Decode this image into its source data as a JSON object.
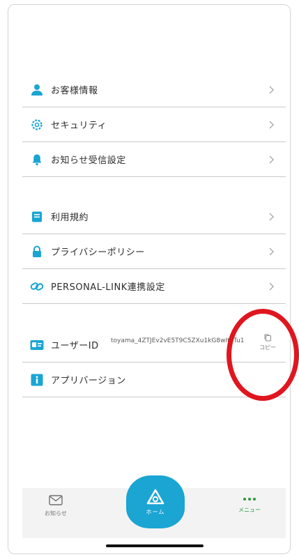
{
  "menu_group_1": [
    {
      "label": "お客様情報",
      "icon": "person-icon"
    },
    {
      "label": "セキュリティ",
      "icon": "gear-icon"
    },
    {
      "label": "お知らせ受信設定",
      "icon": "bell-icon"
    }
  ],
  "menu_group_2": [
    {
      "label": "利用規約",
      "icon": "document-icon"
    },
    {
      "label": "プライバシーポリシー",
      "icon": "lock-icon"
    },
    {
      "label": "PERSONAL-LINK連携設定",
      "icon": "link-icon"
    }
  ],
  "user_id": {
    "label": "ユーザーID",
    "value": "toyama_4ZTJEv2vE5T9C5ZXu1kG8wItyTu1",
    "copy_label": "コピー"
  },
  "app_version": {
    "label": "アプリバージョン"
  },
  "tabbar": {
    "news_label": "お知らせ",
    "home_label": "ホーム",
    "menu_label": "メニュー"
  },
  "colors": {
    "accent": "#1aa5d3",
    "highlight_circle": "#e0161f",
    "menu_active": "#2a9a3d"
  }
}
